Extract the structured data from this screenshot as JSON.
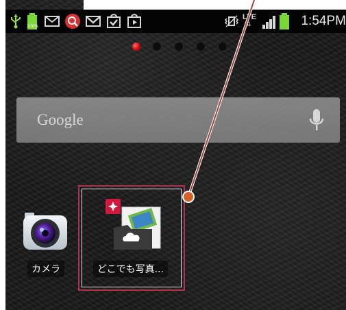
{
  "status_bar": {
    "time": "1:54PM",
    "network_type": "LTE",
    "battery_level_text": "100%",
    "icons": [
      "usb-icon",
      "battery-full-icon",
      "mail-icon",
      "search-app-icon",
      "gmail-icon",
      "task-check-icon",
      "play-store-icon",
      "vibrate-mute-icon",
      "lte-icon",
      "signal-icon",
      "battery-icon"
    ]
  },
  "home": {
    "page_indicator": {
      "pages": 5,
      "current_page": 1
    },
    "search_widget": {
      "label": "Google",
      "mic_icon": "microphone-icon"
    },
    "apps": [
      {
        "label": "カメラ",
        "icon": "camera-app-icon"
      },
      {
        "label": "どこでも写真...",
        "icon": "photo-cloud-app-icon"
      }
    ]
  },
  "colors": {
    "highlight": "#b0324e",
    "annotation_line": "#9a4a3c",
    "status_accent": "#7cd83a"
  }
}
